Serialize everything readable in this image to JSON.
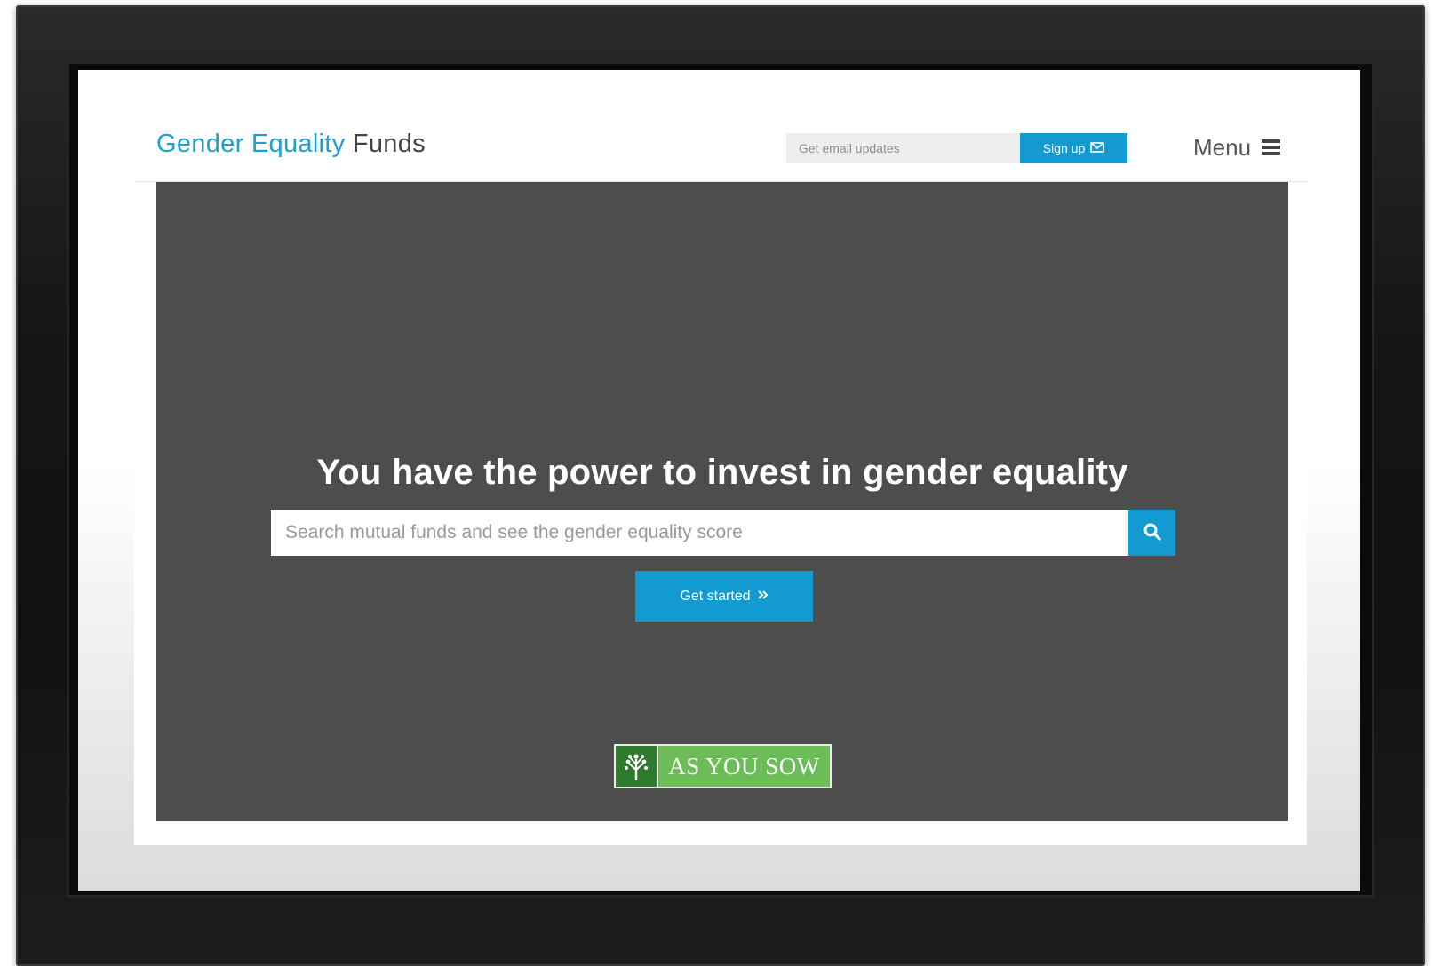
{
  "header": {
    "logo_brand": "Gender Equality",
    "logo_word": "Funds",
    "email_placeholder": "Get email updates",
    "signup_label": "Sign up",
    "menu_label": "Menu"
  },
  "hero": {
    "title": "You have the power to invest in gender equality",
    "search_placeholder": "Search mutual funds and see the gender equality score",
    "get_started_label": "Get started",
    "partner_logo_text": "AS YOU SOW"
  },
  "icons": {
    "signup": "envelope-icon",
    "menu": "hamburger-icon",
    "search": "search-icon",
    "get_started": "double-chevron-right-icon",
    "partner": "tree-icon"
  },
  "colors": {
    "accent": "#139bd1",
    "brand_text": "#1ea1d1",
    "hero_background": "#4d4d4d",
    "partner_green": "#6cbd57",
    "partner_dark_green": "#2f7a2f"
  }
}
